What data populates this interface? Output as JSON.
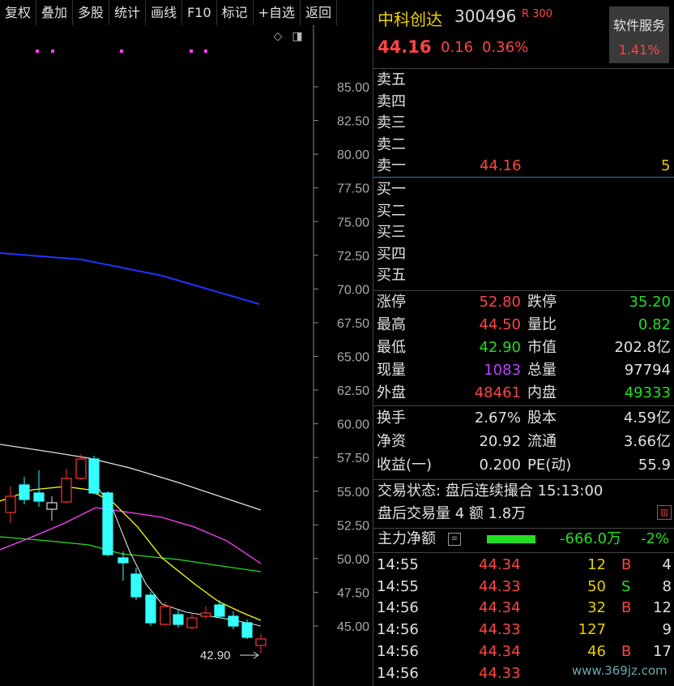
{
  "toolbar": [
    "复权",
    "叠加",
    "多股",
    "统计",
    "画线",
    "F10",
    "标记",
    "+自选",
    "返回"
  ],
  "chart": {
    "price_ticks": [
      "85.00",
      "82.50",
      "80.00",
      "77.50",
      "75.00",
      "72.50",
      "70.00",
      "67.50",
      "65.00",
      "62.50",
      "60.00",
      "57.50",
      "55.00",
      "52.50",
      "50.00",
      "47.50",
      "45.00"
    ],
    "low_marker": "42.90",
    "colors": {
      "up": "#ff3333",
      "down": "#33ffff",
      "ma_white": "#e0e0e0",
      "ma_yellow": "#ffff00",
      "ma_magenta": "#ff40ff",
      "ma_green": "#22dd22",
      "ma_blue": "#2233ff"
    }
  },
  "header": {
    "name": "中科创达",
    "code": "300496",
    "badge": "R 300",
    "price": "44.16",
    "change": "0.16",
    "change_pct": "0.36%",
    "service_label": "软件服务",
    "service_pct": "1.41%"
  },
  "order_book": {
    "asks": [
      {
        "label": "卖五",
        "price": "",
        "vol": ""
      },
      {
        "label": "卖四",
        "price": "",
        "vol": ""
      },
      {
        "label": "卖三",
        "price": "",
        "vol": ""
      },
      {
        "label": "卖二",
        "price": "",
        "vol": ""
      },
      {
        "label": "卖一",
        "price": "44.16",
        "vol": "5"
      }
    ],
    "bids": [
      {
        "label": "买一",
        "price": "",
        "vol": ""
      },
      {
        "label": "买二",
        "price": "",
        "vol": ""
      },
      {
        "label": "买三",
        "price": "",
        "vol": ""
      },
      {
        "label": "买四",
        "price": "",
        "vol": ""
      },
      {
        "label": "买五",
        "price": "",
        "vol": ""
      }
    ]
  },
  "stats": [
    {
      "l1": "涨停",
      "v1": "52.80",
      "c1": "red",
      "l2": "跌停",
      "v2": "35.20",
      "c2": "grn"
    },
    {
      "l1": "最高",
      "v1": "44.50",
      "c1": "red",
      "l2": "量比",
      "v2": "0.82",
      "c2": "grn"
    },
    {
      "l1": "最低",
      "v1": "42.90",
      "c1": "grn",
      "l2": "市值",
      "v2": "202.8亿",
      "c2": "wht"
    },
    {
      "l1": "现量",
      "v1": "1083",
      "c1": "pur",
      "l2": "总量",
      "v2": "97794",
      "c2": "wht"
    },
    {
      "l1": "外盘",
      "v1": "48461",
      "c1": "red",
      "l2": "内盘",
      "v2": "49333",
      "c2": "grn"
    }
  ],
  "stats2": [
    {
      "l1": "换手",
      "v1": "2.67%",
      "l2": "股本",
      "v2": "4.59亿"
    },
    {
      "l1": "净资",
      "v1": "20.92",
      "l2": "流通",
      "v2": "3.66亿"
    },
    {
      "l1": "收益(一)",
      "v1": "0.200",
      "l2": "PE(动)",
      "v2": "55.9"
    }
  ],
  "trade_status": "交易状态: 盘后连续撮合 15:13:00",
  "after_hours": "盘后交易量 4 额 1.8万",
  "main_flow": {
    "label": "主力净额",
    "value": "-666.0万",
    "pct": "-2%"
  },
  "ticks": [
    {
      "t": "14:55",
      "p": "44.34",
      "v": "12",
      "s": "B",
      "n": "4"
    },
    {
      "t": "14:55",
      "p": "44.33",
      "v": "50",
      "s": "S",
      "n": "8"
    },
    {
      "t": "14:56",
      "p": "44.34",
      "v": "32",
      "s": "B",
      "n": "12"
    },
    {
      "t": "14:56",
      "p": "44.33",
      "v": "127",
      "s": "",
      "n": "9"
    },
    {
      "t": "14:56",
      "p": "44.34",
      "v": "46",
      "s": "B",
      "n": "17"
    },
    {
      "t": "14:56",
      "p": "44.33",
      "v": "",
      "s": "",
      "n": ""
    }
  ],
  "watermark": "www.369jz.com"
}
